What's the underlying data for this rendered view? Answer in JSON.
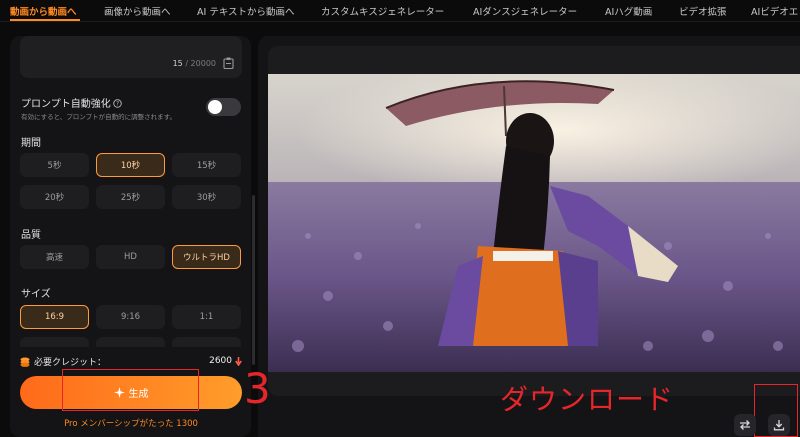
{
  "nav": {
    "tabs": [
      {
        "label": "動画から動画へ"
      },
      {
        "label": "画像から動画へ"
      },
      {
        "label": "AI テキストから動画へ"
      },
      {
        "label": "カスタムキスジェネレーター"
      },
      {
        "label": "AIダンスジェネレーター"
      },
      {
        "label": "AIハグ動画"
      },
      {
        "label": "ビデオ拡張"
      },
      {
        "label": "AIビデオエ"
      }
    ]
  },
  "prompt": {
    "count": "15",
    "max": "/ 20000",
    "enhance_label": "プロンプト自動強化",
    "enhance_help_icon": "help-circle-icon",
    "enhance_desc": "有効にすると、プロンプトが自動的に調整されます。",
    "enhance_enabled": false
  },
  "duration": {
    "label": "期間",
    "options": [
      "5秒",
      "10秒",
      "15秒",
      "20秒",
      "25秒",
      "30秒"
    ],
    "selected": "10秒"
  },
  "quality": {
    "label": "品質",
    "options": [
      "高速",
      "HD",
      "ウルトラHD"
    ],
    "selected": "ウルトラHD"
  },
  "size": {
    "label": "サイズ",
    "options": [
      "16:9",
      "9:16",
      "1:1"
    ],
    "selected": "16:9"
  },
  "credits": {
    "label": "必要クレジット：",
    "value": "2600"
  },
  "generate": {
    "label": "生成"
  },
  "promo": {
    "text": "Pro メンバーシップがたった 1300"
  },
  "annotations": {
    "step": "3",
    "download": "ダウンロード"
  },
  "colors": {
    "accent": "#ff8a1f",
    "annotation": "#e6262a",
    "panel": "#141416"
  }
}
